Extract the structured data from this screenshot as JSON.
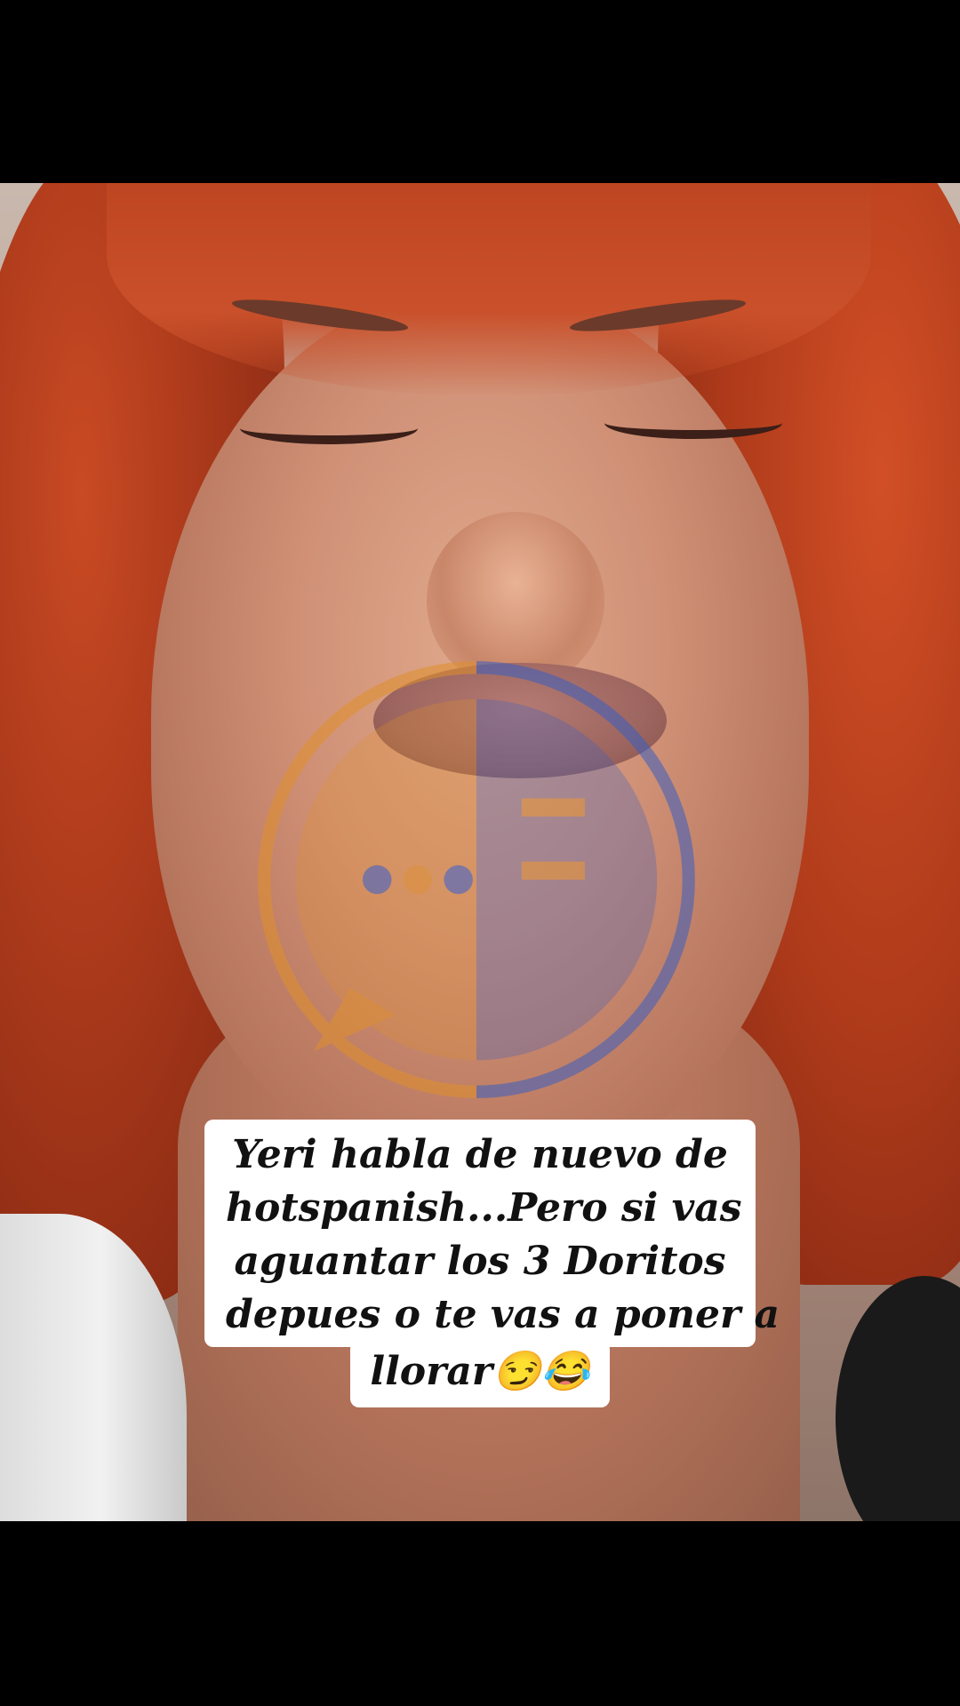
{
  "caption": {
    "lines": [
      "Yeri habla de nuevo de",
      "hotspanish...Pero si vas",
      "aguantar los 3 Doritos",
      "depues o te vas a poner a",
      "llorar😏😂"
    ]
  },
  "watermark": {
    "icon": "speech-bubble-logo-icon",
    "colors": {
      "left": "#e0902a",
      "right": "#3a5fc0"
    }
  },
  "colors": {
    "letterbox": "#000000",
    "caption_bg": "#ffffff",
    "caption_text": "#111111",
    "hair": "#c94a24"
  }
}
